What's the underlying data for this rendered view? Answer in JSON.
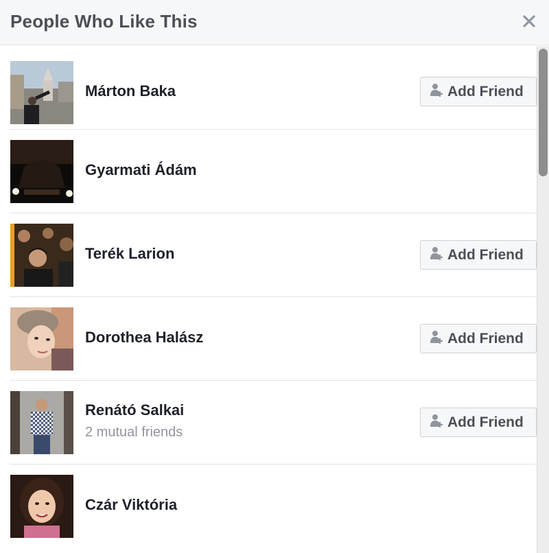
{
  "dialog": {
    "title": "People Who Like This",
    "close_icon": "close-icon"
  },
  "people": [
    {
      "name": "Márton Baka",
      "subtitle": "",
      "button": "Add Friend"
    },
    {
      "name": "Gyarmati Ádám",
      "subtitle": "",
      "button": ""
    },
    {
      "name": "Terék Larion",
      "subtitle": "",
      "button": "Add Friend"
    },
    {
      "name": "Dorothea Halász",
      "subtitle": "",
      "button": "Add Friend"
    },
    {
      "name": "Renátó Salkai",
      "subtitle": "2 mutual friends",
      "button": "Add Friend"
    },
    {
      "name": "Czár Viktória",
      "subtitle": "",
      "button": ""
    }
  ],
  "colors": {
    "header_bg": "#f6f7f9",
    "name_text": "#1d2129",
    "muted_text": "#90949c",
    "button_text": "#4b4f56"
  },
  "icons": {
    "add_friend": "add-friend-icon"
  }
}
